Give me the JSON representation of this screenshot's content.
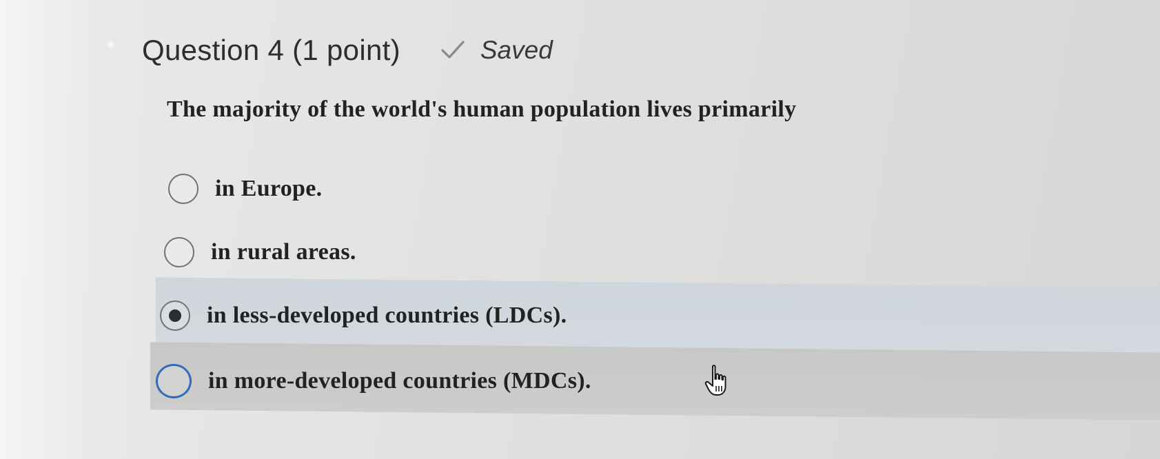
{
  "question": {
    "title": "Question 4 (1 point)",
    "status_label": "Saved",
    "status_icon": "check-icon",
    "prompt": "The majority of the world's human population lives primarily"
  },
  "options": [
    {
      "label": "in Europe.",
      "selected": false
    },
    {
      "label": "in rural areas.",
      "selected": false
    },
    {
      "label": "in less-developed countries (LDCs).",
      "selected": true
    },
    {
      "label": "in more-developed countries (MDCs).",
      "selected": false,
      "focused": true
    }
  ],
  "colors": {
    "focus_ring": "#2f6bb7",
    "selected_row": "#d1d8dd",
    "hover_row": "#cacac9"
  }
}
